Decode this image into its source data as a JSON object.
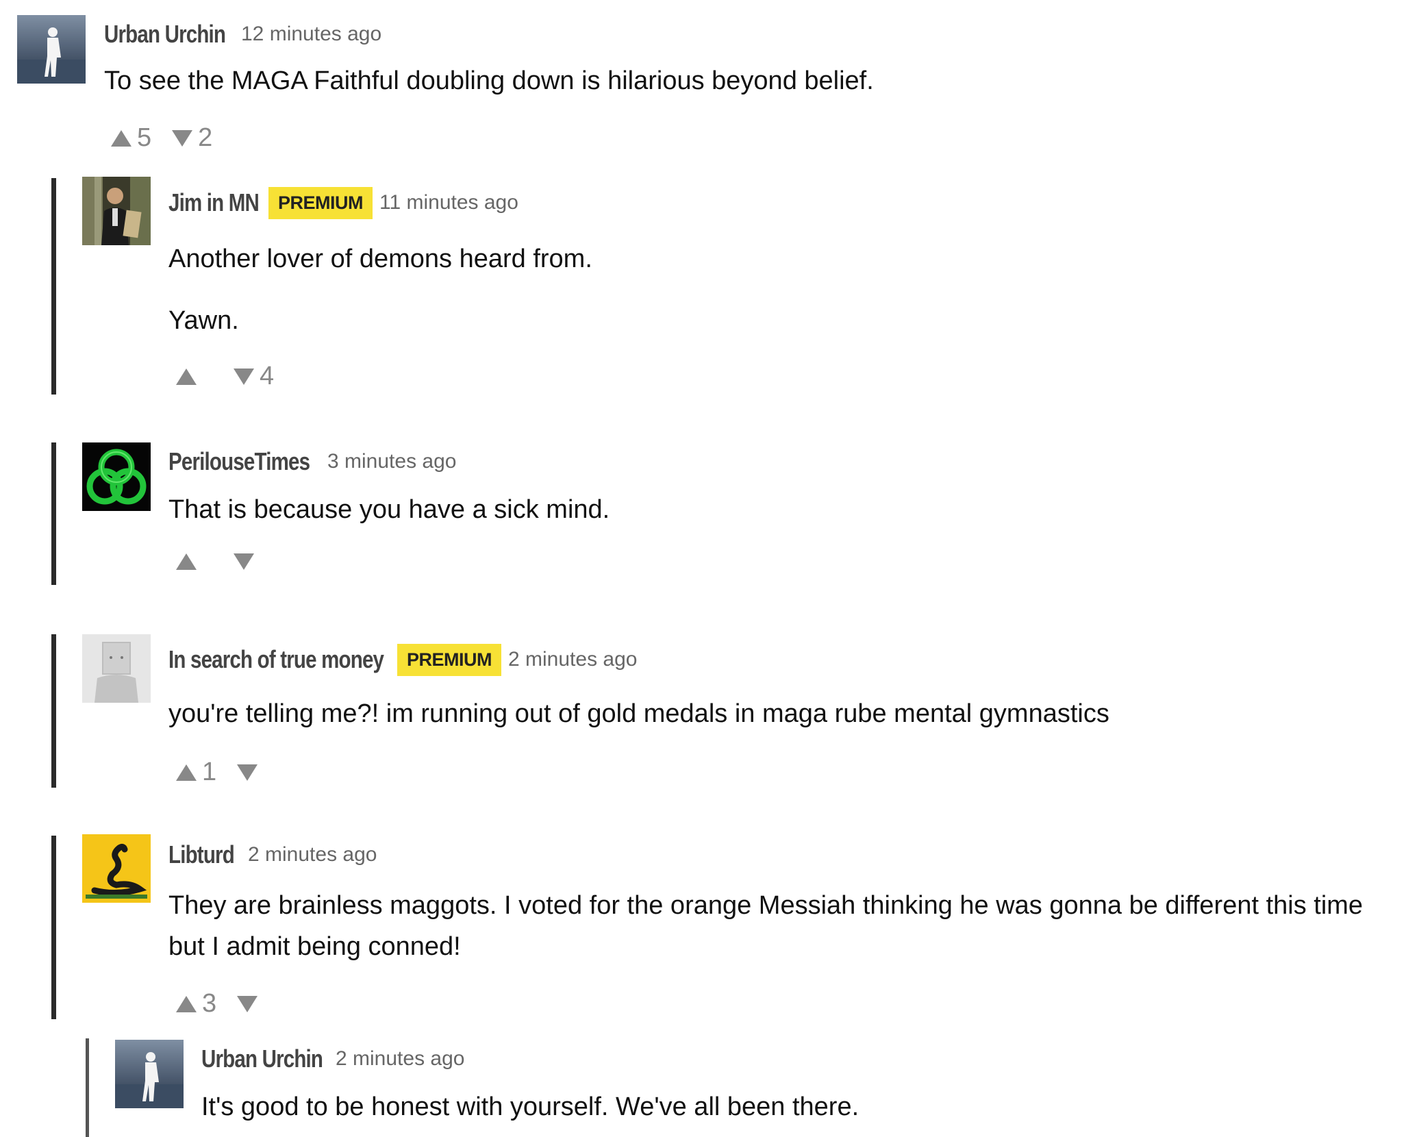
{
  "comments": [
    {
      "author": "Urban Urchin",
      "time": "12 minutes ago",
      "premium": false,
      "body": [
        "To see the MAGA Faithful doubling down is hilarious beyond belief."
      ],
      "upvotes": "5",
      "downvotes": "2",
      "avatar": "urban-urchin-avatar"
    },
    {
      "author": "Jim in MN",
      "badge": "PREMIUM",
      "time": "11 minutes ago",
      "premium": true,
      "body": [
        "Another lover of demons heard from.",
        "Yawn."
      ],
      "upvotes": "",
      "downvotes": "4",
      "avatar": "jim-avatar"
    },
    {
      "author": "PerilouseTimes",
      "time": "3 minutes ago",
      "premium": false,
      "body": [
        "That is because you have a sick mind."
      ],
      "upvotes": "",
      "downvotes": "",
      "avatar": "green-knot-avatar"
    },
    {
      "author": "In search of true money",
      "badge": "PREMIUM",
      "time": "2 minutes ago",
      "premium": true,
      "body": [
        "you're telling me?! im running out of gold medals in maga rube mental gymnastics"
      ],
      "upvotes": "1",
      "downvotes": "",
      "avatar": "box-head-avatar"
    },
    {
      "author": "Libturd",
      "time": "2 minutes ago",
      "premium": false,
      "body": [
        "They are brainless maggots. I voted for the orange Messiah thinking he was gonna be different this time but I admit being conned!"
      ],
      "upvotes": "3",
      "downvotes": "",
      "avatar": "gadsden-flag-avatar"
    },
    {
      "author": "Urban Urchin",
      "time": "2 minutes ago",
      "premium": false,
      "body": [
        "It's good to be honest with yourself. We've all been there."
      ],
      "avatar": "urban-urchin-avatar"
    }
  ],
  "colors": {
    "badge": "#f7e135",
    "rail": "#2a2a2a",
    "vote": "#888888"
  }
}
